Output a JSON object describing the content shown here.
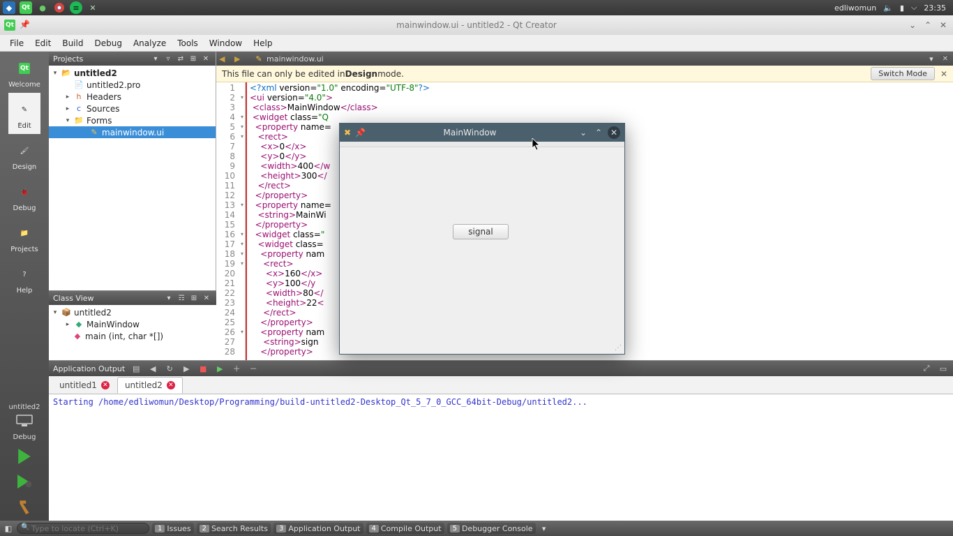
{
  "kde": {
    "user": "edliwomun",
    "time": "23:35"
  },
  "window": {
    "title": "mainwindow.ui - untitled2 - Qt Creator"
  },
  "menu": [
    "File",
    "Edit",
    "Build",
    "Debug",
    "Analyze",
    "Tools",
    "Window",
    "Help"
  ],
  "modes": [
    {
      "label": "Welcome"
    },
    {
      "label": "Edit",
      "selected": true
    },
    {
      "label": "Design"
    },
    {
      "label": "Debug"
    },
    {
      "label": "Projects"
    },
    {
      "label": "Help"
    }
  ],
  "kit": {
    "name": "untitled2",
    "config": "Debug"
  },
  "projects_pane": {
    "title": "Projects",
    "tree": {
      "root": "untitled2",
      "pro": "untitled2.pro",
      "headers": "Headers",
      "sources": "Sources",
      "forms": "Forms",
      "ui_file": "mainwindow.ui"
    }
  },
  "classview": {
    "title": "Class View",
    "root": "untitled2",
    "class": "MainWindow",
    "fn": "main (int, char *[])"
  },
  "editor": {
    "tab": "mainwindow.ui",
    "banner_pre": "This file can only be edited in ",
    "banner_bold": "Design",
    "banner_post": " mode.",
    "switch": "Switch Mode",
    "lines": [
      {
        "n": 1,
        "fold": false,
        "html": "<span class='pi'>&lt;?xml</span> version=<span class='str'>\"1.0\"</span> encoding=<span class='str'>\"UTF-8\"</span><span class='pi'>?&gt;</span>"
      },
      {
        "n": 2,
        "fold": true,
        "html": "<span class='tag'>&lt;ui</span> version=<span class='str'>\"4.0\"</span><span class='tag'>&gt;</span>"
      },
      {
        "n": 3,
        "fold": false,
        "html": " <span class='tag'>&lt;class&gt;</span>MainWindow<span class='tag'>&lt;/class&gt;</span>"
      },
      {
        "n": 4,
        "fold": true,
        "html": " <span class='tag'>&lt;widget</span> class=<span class='str'>\"Q</span>"
      },
      {
        "n": 5,
        "fold": true,
        "html": "  <span class='tag'>&lt;property</span> name="
      },
      {
        "n": 6,
        "fold": true,
        "html": "   <span class='tag'>&lt;rect&gt;</span>"
      },
      {
        "n": 7,
        "fold": false,
        "html": "    <span class='tag'>&lt;x&gt;</span>0<span class='tag'>&lt;/x&gt;</span>"
      },
      {
        "n": 8,
        "fold": false,
        "html": "    <span class='tag'>&lt;y&gt;</span>0<span class='tag'>&lt;/y&gt;</span>"
      },
      {
        "n": 9,
        "fold": false,
        "html": "    <span class='tag'>&lt;width&gt;</span>400<span class='tag'>&lt;/w</span>"
      },
      {
        "n": 10,
        "fold": false,
        "html": "    <span class='tag'>&lt;height&gt;</span>300<span class='tag'>&lt;/</span>"
      },
      {
        "n": 11,
        "fold": false,
        "html": "   <span class='tag'>&lt;/rect&gt;</span>"
      },
      {
        "n": 12,
        "fold": false,
        "html": "  <span class='tag'>&lt;/property&gt;</span>"
      },
      {
        "n": 13,
        "fold": true,
        "html": "  <span class='tag'>&lt;property</span> name="
      },
      {
        "n": 14,
        "fold": false,
        "html": "   <span class='tag'>&lt;string&gt;</span>MainWi"
      },
      {
        "n": 15,
        "fold": false,
        "html": "  <span class='tag'>&lt;/property&gt;</span>"
      },
      {
        "n": 16,
        "fold": true,
        "html": "  <span class='tag'>&lt;widget</span> class=<span class='str'>\"</span>"
      },
      {
        "n": 17,
        "fold": true,
        "html": "   <span class='tag'>&lt;widget</span> class="
      },
      {
        "n": 18,
        "fold": true,
        "html": "    <span class='tag'>&lt;property</span> nam"
      },
      {
        "n": 19,
        "fold": true,
        "html": "     <span class='tag'>&lt;rect&gt;</span>"
      },
      {
        "n": 20,
        "fold": false,
        "html": "      <span class='tag'>&lt;x&gt;</span>160<span class='tag'>&lt;/x&gt;</span>"
      },
      {
        "n": 21,
        "fold": false,
        "html": "      <span class='tag'>&lt;y&gt;</span>100<span class='tag'>&lt;/y</span>"
      },
      {
        "n": 22,
        "fold": false,
        "html": "      <span class='tag'>&lt;width&gt;</span>80<span class='tag'>&lt;/</span>"
      },
      {
        "n": 23,
        "fold": false,
        "html": "      <span class='tag'>&lt;height&gt;</span>22<span class='tag'>&lt;</span>"
      },
      {
        "n": 24,
        "fold": false,
        "html": "     <span class='tag'>&lt;/rect&gt;</span>"
      },
      {
        "n": 25,
        "fold": false,
        "html": "    <span class='tag'>&lt;/property&gt;</span>"
      },
      {
        "n": 26,
        "fold": true,
        "html": "    <span class='tag'>&lt;property</span> nam"
      },
      {
        "n": 27,
        "fold": false,
        "html": "     <span class='tag'>&lt;string&gt;</span>sign"
      },
      {
        "n": 28,
        "fold": false,
        "html": "    <span class='tag'>&lt;/property&gt;</span>"
      }
    ]
  },
  "output": {
    "title": "Application Output",
    "tabs": [
      {
        "label": "untitled1",
        "active": false
      },
      {
        "label": "untitled2",
        "active": true
      }
    ],
    "text": "Starting /home/edliwomun/Desktop/Programming/build-untitled2-Desktop_Qt_5_7_0_GCC_64bit-Debug/untitled2..."
  },
  "status": {
    "locate_placeholder": "Type to locate (Ctrl+K)",
    "panes": [
      {
        "n": "1",
        "label": "Issues"
      },
      {
        "n": "2",
        "label": "Search Results"
      },
      {
        "n": "3",
        "label": "Application Output"
      },
      {
        "n": "4",
        "label": "Compile Output"
      },
      {
        "n": "5",
        "label": "Debugger Console"
      }
    ]
  },
  "app_window": {
    "title": "MainWindow",
    "button": "signal"
  }
}
